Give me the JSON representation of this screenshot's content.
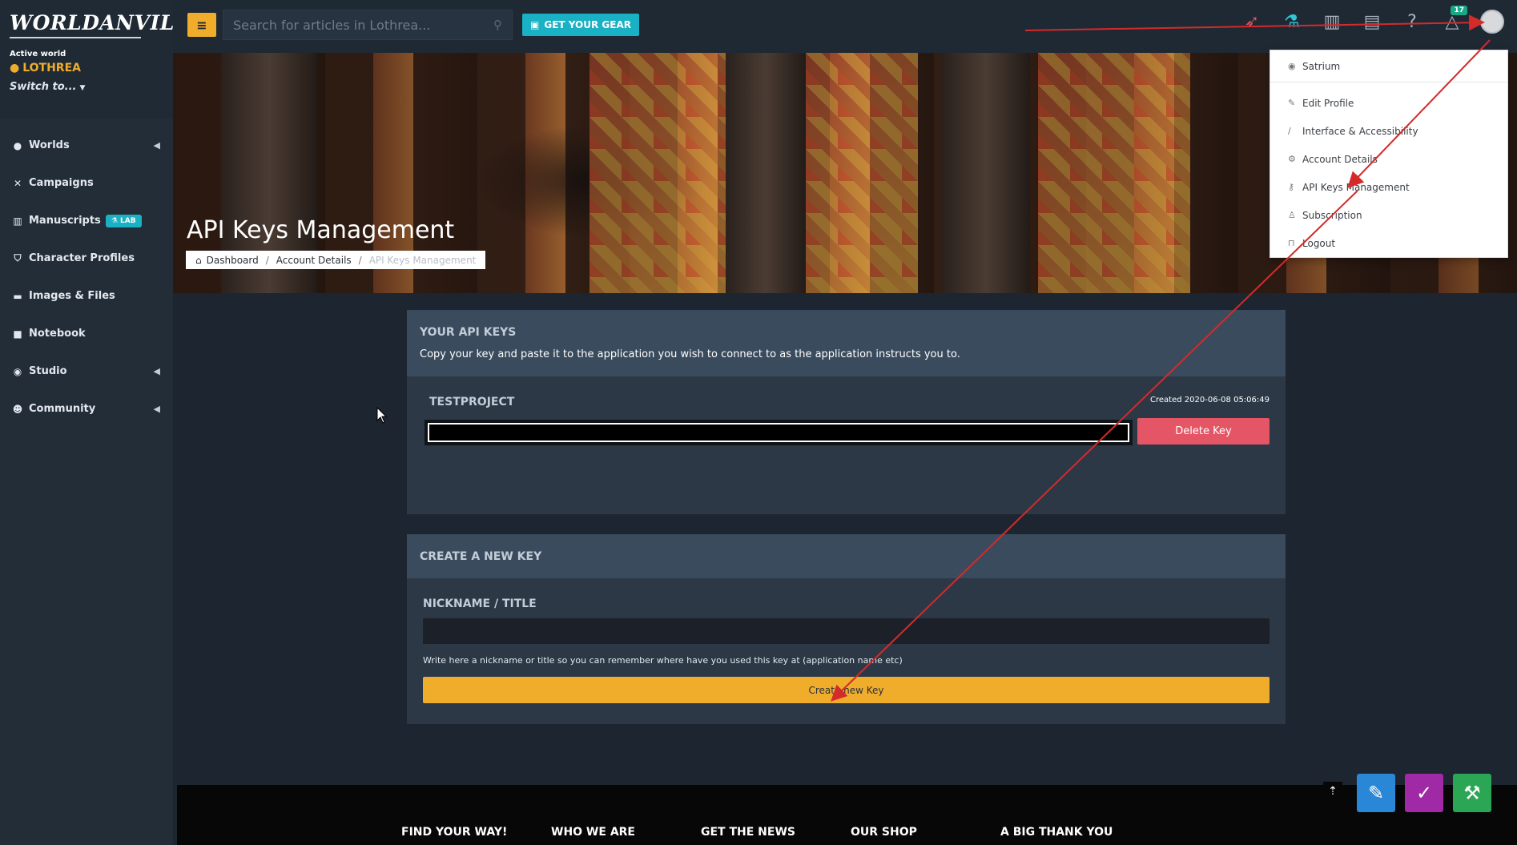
{
  "sidebar": {
    "logo": "WORLDANVIL",
    "active_world_label": "Active world",
    "world_name": "LOTHREA",
    "switch_to": "Switch to...",
    "items": [
      {
        "label": "Worlds",
        "icon": "globe-icon",
        "has_chevron": true
      },
      {
        "label": "Campaigns",
        "icon": "swords-icon",
        "has_chevron": false
      },
      {
        "label": "Manuscripts",
        "icon": "books-icon",
        "has_chevron": false,
        "badge": "LAB"
      },
      {
        "label": "Character Profiles",
        "icon": "shield-icon",
        "has_chevron": false
      },
      {
        "label": "Images & Files",
        "icon": "folder-icon",
        "has_chevron": false
      },
      {
        "label": "Notebook",
        "icon": "book-icon",
        "has_chevron": false
      },
      {
        "label": "Studio",
        "icon": "palette-icon",
        "has_chevron": true
      },
      {
        "label": "Community",
        "icon": "users-icon",
        "has_chevron": true
      }
    ]
  },
  "topbar": {
    "search_placeholder": "Search for articles in Lothrea...",
    "gear_button": "GET YOUR GEAR",
    "notification_count": "17"
  },
  "banner": {
    "title": "API Keys Management",
    "breadcrumb": [
      "Dashboard",
      "Account Details",
      "API Keys Management"
    ]
  },
  "dropdown": {
    "items": [
      {
        "label": "Satrium",
        "icon": "eye-icon"
      },
      {
        "label": "Edit Profile",
        "icon": "pencil-icon"
      },
      {
        "label": "Interface & Accessibility",
        "icon": "brush-icon"
      },
      {
        "label": "Account Details",
        "icon": "gear-icon"
      },
      {
        "label": "API Keys Management",
        "icon": "key-icon"
      },
      {
        "label": "Subscription",
        "icon": "person-icon"
      },
      {
        "label": "Logout",
        "icon": "lock-icon"
      }
    ]
  },
  "api_keys": {
    "title": "YOUR API KEYS",
    "description": "Copy your key and paste it to the application you wish to connect to as the application instructs you to.",
    "key_name": "TESTPROJECT",
    "created": "Created 2020-06-08 05:06:49",
    "delete_button": "Delete Key"
  },
  "create_key": {
    "title": "CREATE A NEW KEY",
    "field_label": "NICKNAME / TITLE",
    "help_text": "Write here a nickname or title so you can remember where have you used this key at (application name etc)",
    "button": "Create new Key"
  },
  "footer": {
    "links": [
      "FIND YOUR WAY!",
      "WHO WE ARE",
      "GET THE NEWS",
      "OUR SHOP",
      "A BIG THANK YOU"
    ]
  },
  "colors": {
    "accent": "#f0ad2c",
    "teal": "#1bb1c4",
    "danger": "#e45566",
    "annotation": "#d42a2a"
  }
}
